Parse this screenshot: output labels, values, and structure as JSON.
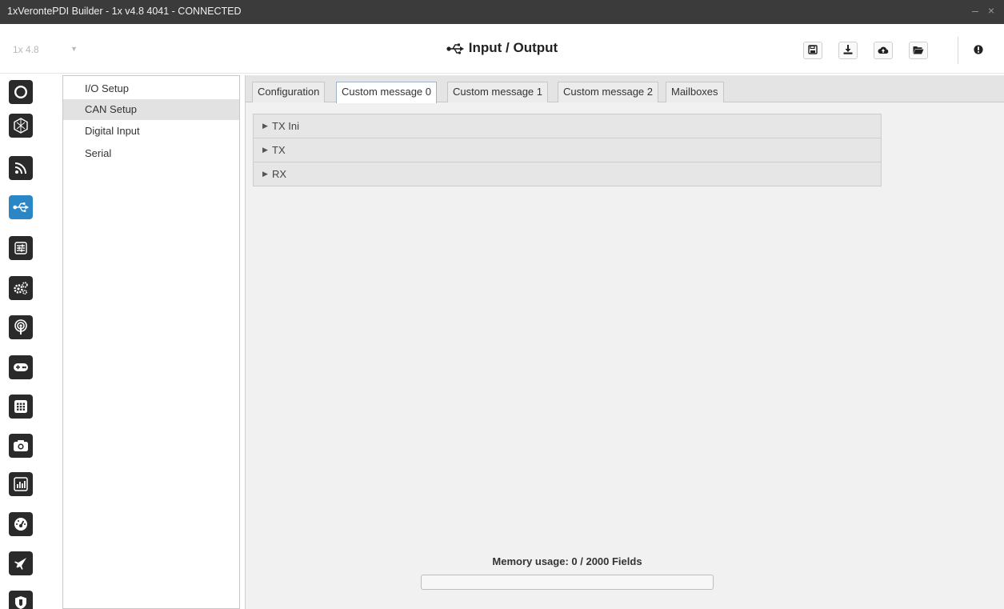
{
  "window": {
    "title": "1xVerontePDI Builder - 1x v4.8 4041 - CONNECTED",
    "controls": "– ×"
  },
  "header": {
    "version_value": "1x 4.8",
    "title": "Input / Output",
    "title_icon": "usb-icon",
    "toolbar_icons": [
      "save-icon",
      "download-icon",
      "cloud-upload-icon",
      "folder-open-icon",
      "alert-icon"
    ]
  },
  "rail": {
    "active_color": "#2b86c5",
    "items": [
      {
        "icon": "ring-icon"
      },
      {
        "icon": "hexagon-icon"
      },
      {
        "icon": "signal-icon"
      },
      {
        "icon": "usb-icon",
        "active": true
      },
      {
        "icon": "sliders-icon"
      },
      {
        "icon": "gears-icon"
      },
      {
        "icon": "broadcast-icon"
      },
      {
        "icon": "gamepad-icon"
      },
      {
        "icon": "grid-icon"
      },
      {
        "icon": "camera-icon"
      },
      {
        "icon": "chart-icon"
      },
      {
        "icon": "gauge-icon"
      },
      {
        "icon": "plane-icon"
      },
      {
        "icon": "shield-icon"
      }
    ]
  },
  "submenu": {
    "items": [
      {
        "label": "I/O Setup"
      },
      {
        "label": "CAN Setup",
        "selected": true
      },
      {
        "label": "Digital Input"
      },
      {
        "label": "Serial"
      }
    ]
  },
  "tabs": [
    {
      "label": "Configuration"
    },
    {
      "label": "Custom message 0",
      "active": true
    },
    {
      "label": "Custom message 1"
    },
    {
      "label": "Custom message 2"
    },
    {
      "label": "Mailboxes"
    }
  ],
  "sections": [
    {
      "label": "TX Ini"
    },
    {
      "label": "TX"
    },
    {
      "label": "RX"
    }
  ],
  "memory": {
    "label": "Memory usage: 0 / 2000 Fields",
    "used": 0,
    "total": 2000
  }
}
